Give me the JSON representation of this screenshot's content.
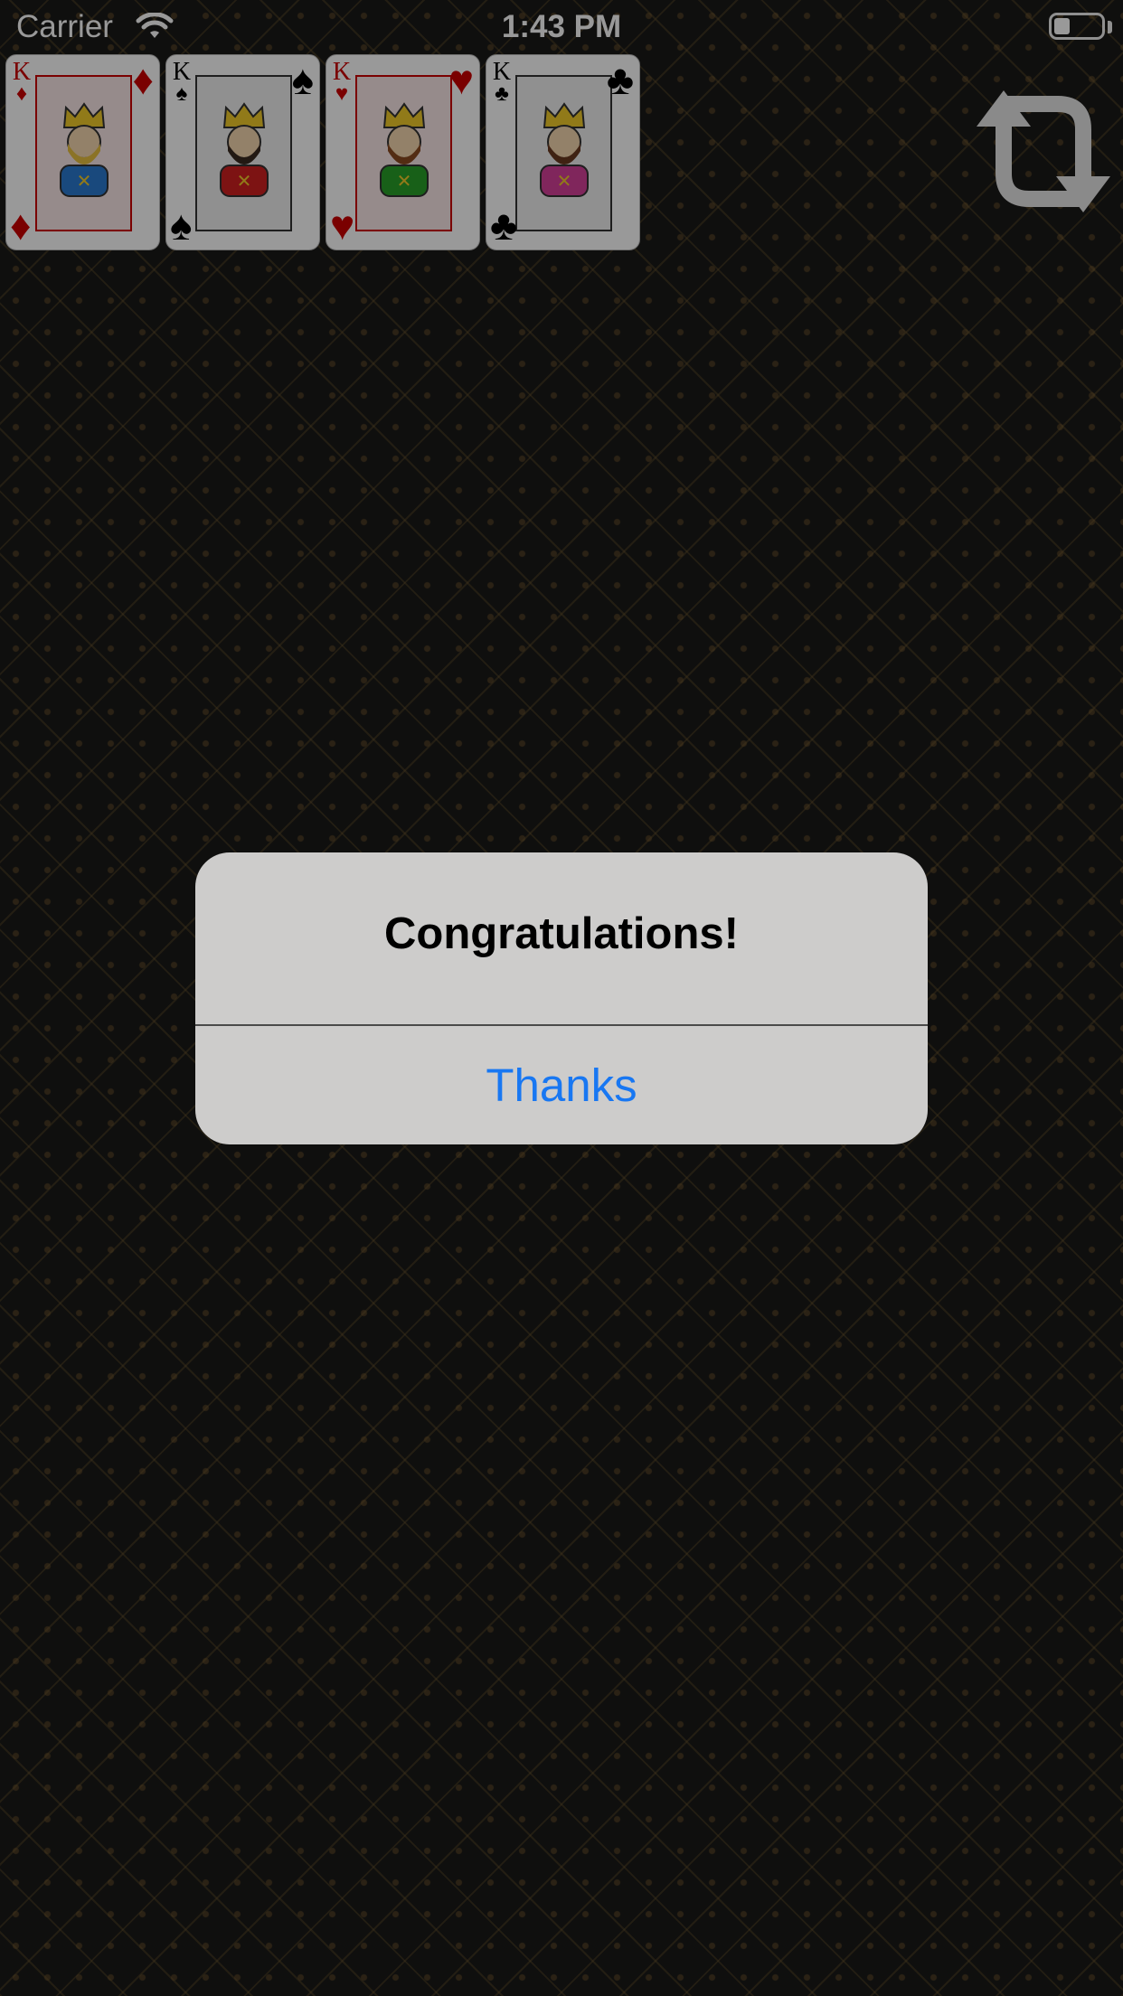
{
  "status_bar": {
    "carrier": "Carrier",
    "time": "1:43 PM",
    "battery_level": 0.3
  },
  "foundation_cards": [
    {
      "rank": "K",
      "suit": "♦",
      "color": "red",
      "robe": "#2b7bd0"
    },
    {
      "rank": "K",
      "suit": "♠",
      "color": "black",
      "robe": "#d12020"
    },
    {
      "rank": "K",
      "suit": "♥",
      "color": "red",
      "robe": "#28a028"
    },
    {
      "rank": "K",
      "suit": "♣",
      "color": "black",
      "robe": "#d6409a"
    }
  ],
  "controls": {
    "reload_icon": "reload-icon"
  },
  "alert": {
    "title": "Congratulations!",
    "button_label": "Thanks"
  },
  "colors": {
    "felt": "#1a1918",
    "alert_bg": "#cdcccb",
    "accent": "#1877f2",
    "red_suit": "#cc0000"
  }
}
